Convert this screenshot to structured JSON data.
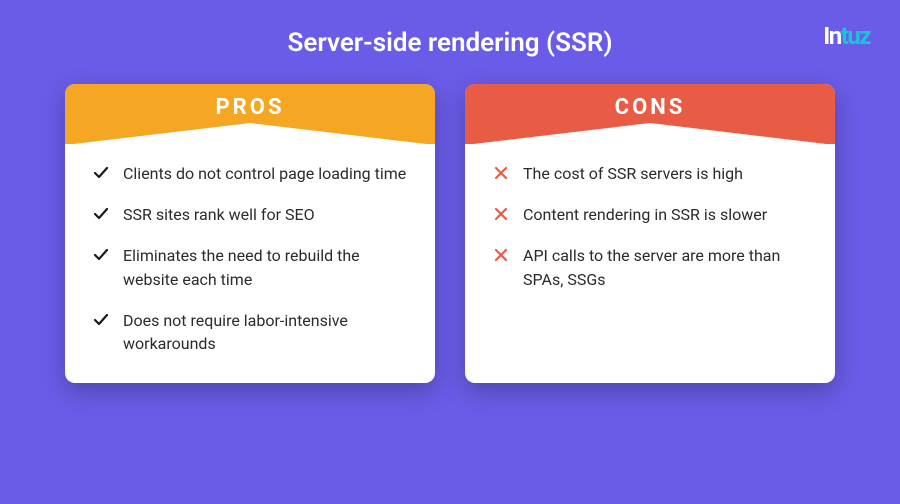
{
  "logo": {
    "part1": "In",
    "part2": "tuz"
  },
  "title": "Server-side rendering (SSR)",
  "pros": {
    "header": "PROS",
    "items": [
      "Clients do not control page loading time",
      "SSR sites rank well for SEO",
      "Eliminates the need to rebuild the website each time",
      "Does not require labor-intensive workarounds"
    ]
  },
  "cons": {
    "header": "CONS",
    "items": [
      "The cost of SSR servers is high",
      "Content rendering in SSR is slower",
      "API calls to the server are more than SPAs, SSGs"
    ]
  }
}
